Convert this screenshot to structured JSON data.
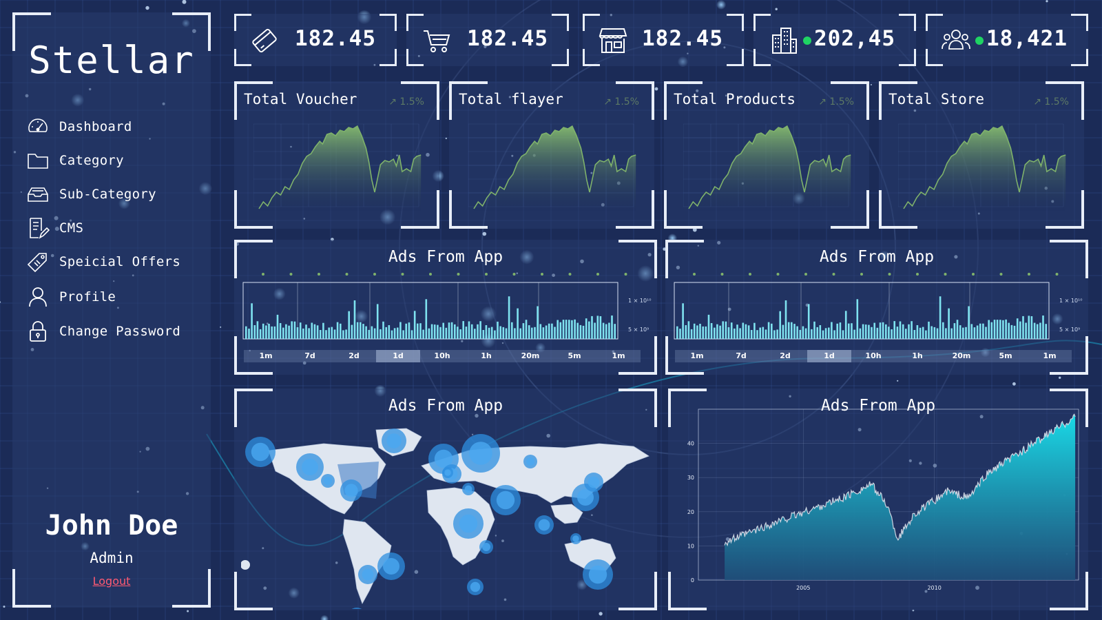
{
  "brand": "Stellar",
  "nav": [
    {
      "label": "Dashboard",
      "icon": "dashboard-gauge-icon"
    },
    {
      "label": "Category",
      "icon": "folder-icon"
    },
    {
      "label": "Sub-Category",
      "icon": "inbox-tray-icon"
    },
    {
      "label": "CMS",
      "icon": "document-edit-icon"
    },
    {
      "label": "Speicial Offers",
      "icon": "tag-icon"
    },
    {
      "label": "Profile",
      "icon": "user-icon"
    },
    {
      "label": "Change Password",
      "icon": "lock-icon"
    }
  ],
  "user": {
    "name": "John Doe",
    "role": "Admin",
    "logout": "Logout"
  },
  "stats": [
    {
      "value": "182.45",
      "icon": "credit-card-icon",
      "online": false
    },
    {
      "value": "182.45",
      "icon": "shopping-cart-icon",
      "online": false
    },
    {
      "value": "182.45",
      "icon": "storefront-icon",
      "online": false
    },
    {
      "value": "202,45",
      "icon": "buildings-icon",
      "online": true
    },
    {
      "value": "18,421",
      "icon": "people-group-icon",
      "online": true
    }
  ],
  "cards": [
    {
      "title": "Total Voucher",
      "change": "1.5%"
    },
    {
      "title": "Total flayer",
      "change": "1.5%"
    },
    {
      "title": "Total Products",
      "change": "1.5%"
    },
    {
      "title": "Total Store",
      "change": "1.5%"
    }
  ],
  "ads_panels": [
    {
      "title": "Ads From App",
      "y_labels": [
        "1 × 10¹⁰",
        "5 × 10⁹"
      ],
      "timeframes": [
        "1m",
        "7d",
        "2d",
        "1d",
        "10h",
        "1h",
        "20m",
        "5m",
        "1m"
      ],
      "active": "1d"
    },
    {
      "title": "Ads From App",
      "y_labels": [
        "1 × 10¹⁰",
        "5 × 10⁹"
      ],
      "timeframes": [
        "1m",
        "7d",
        "2d",
        "1d",
        "10h",
        "1h",
        "20m",
        "5m",
        "1m"
      ],
      "active": "1d"
    }
  ],
  "map_panel": {
    "title": "Ads From App"
  },
  "area_panel": {
    "title": "Ads From App",
    "y_ticks": [
      "0",
      "10",
      "20",
      "30",
      "40"
    ],
    "x_ticks": [
      "2005",
      "2010"
    ]
  },
  "colors": {
    "accent_green": "#1fd463",
    "spark_green": "#7fb26b",
    "area_cyan": "#1ad9e6",
    "bar_cyan": "#7fe3f0",
    "bubble_blue": "#2e8fe0",
    "logout_red": "#ff5a72"
  }
}
